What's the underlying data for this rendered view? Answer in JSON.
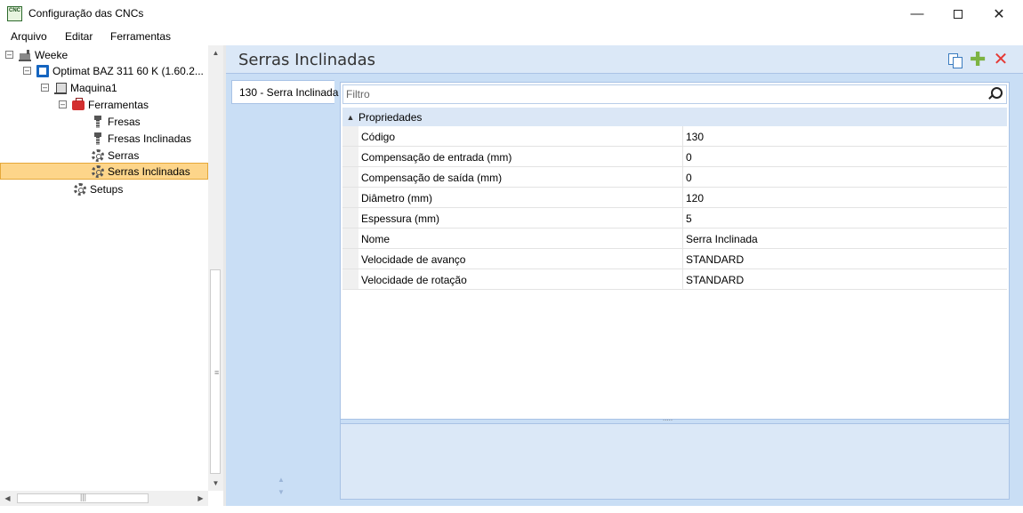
{
  "window": {
    "title": "Configuração das CNCs",
    "app_icon_text": "CNC",
    "minimize_icon": "minimize-icon",
    "maximize_icon": "maximize-icon",
    "close_icon": "close-icon"
  },
  "menu": {
    "items": [
      "Arquivo",
      "Editar",
      "Ferramentas"
    ]
  },
  "tree": {
    "nodes": [
      {
        "label": "Weeke",
        "icon": "factory-icon",
        "expanded": true
      },
      {
        "label": "Optimat BAZ 311 60 K (1.60.2...",
        "icon": "machine-icon",
        "expanded": true
      },
      {
        "label": "Maquina1",
        "icon": "cnc-icon",
        "expanded": true
      },
      {
        "label": "Ferramentas",
        "icon": "toolbox-icon",
        "expanded": true
      },
      {
        "label": "Fresas",
        "icon": "drill-bit-icon"
      },
      {
        "label": "Fresas Inclinadas",
        "icon": "drill-bit-icon"
      },
      {
        "label": "Serras",
        "icon": "gear-icon"
      },
      {
        "label": "Serras Inclinadas",
        "icon": "gear-icon",
        "selected": true
      },
      {
        "label": "Setups",
        "icon": "gear-icon"
      }
    ]
  },
  "main": {
    "title": "Serras Inclinadas",
    "toolbar": {
      "copy_icon": "copy-icon",
      "add_icon": "add-icon",
      "delete_icon": "delete-icon"
    },
    "list": {
      "items": [
        "130 - Serra Inclinada"
      ]
    },
    "filter": {
      "placeholder": "Filtro",
      "value": ""
    },
    "properties": {
      "category": "Propriedades",
      "rows": [
        {
          "name": "Código",
          "value": "130"
        },
        {
          "name": "Compensação de entrada (mm)",
          "value": "0"
        },
        {
          "name": "Compensação de saída (mm)",
          "value": "0"
        },
        {
          "name": "Diâmetro (mm)",
          "value": "120"
        },
        {
          "name": "Espessura (mm)",
          "value": "5"
        },
        {
          "name": "Nome",
          "value": "Serra Inclinada"
        },
        {
          "name": "Velocidade de avanço",
          "value": "STANDARD"
        },
        {
          "name": "Velocidade de rotação",
          "value": "STANDARD"
        }
      ]
    }
  },
  "colors": {
    "selection_bg": "#fdd58a",
    "panel_bg": "#dbe8f7",
    "inner_bg": "#c9def5",
    "add": "#7cb342",
    "delete": "#e53935"
  }
}
